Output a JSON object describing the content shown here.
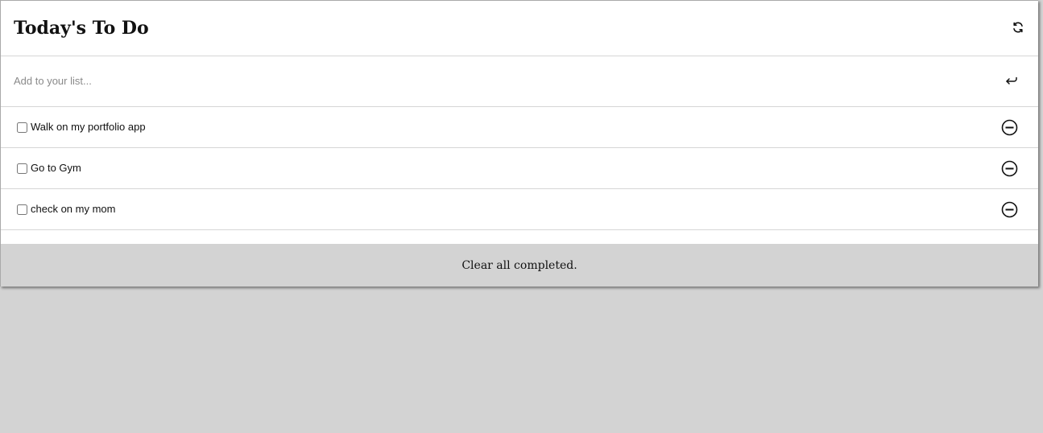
{
  "header": {
    "title": "Today's To Do",
    "refresh_icon": "refresh-icon"
  },
  "add": {
    "placeholder": "Add to your list...",
    "value": "",
    "submit_icon": "enter-arrow-icon"
  },
  "todos": [
    {
      "text": "Walk on my portfolio app",
      "completed": false
    },
    {
      "text": "Go to Gym",
      "completed": false
    },
    {
      "text": "check on my mom",
      "completed": false
    }
  ],
  "footer": {
    "clear_label": "Clear all completed."
  },
  "colors": {
    "background": "#d3d3d3",
    "card": "#ffffff",
    "divider": "#d6d6d6",
    "text": "#111111"
  }
}
